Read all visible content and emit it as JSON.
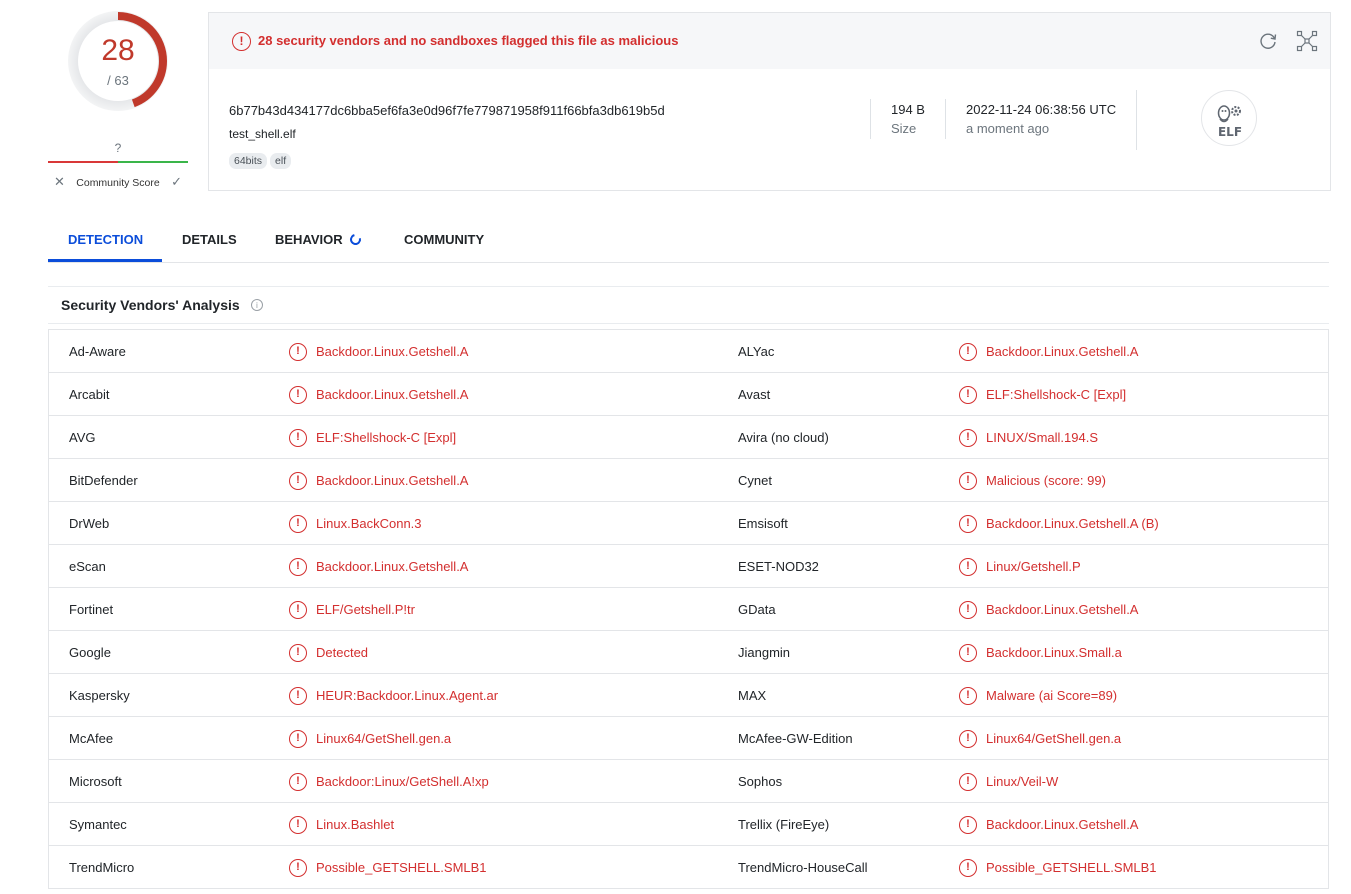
{
  "score": {
    "detections": "28",
    "total": "/ 63",
    "community_q": "?",
    "community_label": "Community Score",
    "x_glyph": "✕",
    "check_glyph": "✓",
    "gauge_fraction": 0.444
  },
  "summary": {
    "alert": "28 security vendors and no sandboxes flagged this file as malicious",
    "alert_glyph": "!",
    "hash": "6b77b43d434177dc6bba5ef6fa3e0d96f7fe779871958f911f66bfa3db619b5d",
    "filename": "test_shell.elf",
    "tags": [
      "64bits",
      "elf"
    ],
    "size_value": "194 B",
    "size_label": "Size",
    "date_value": "2022-11-24 06:38:56 UTC",
    "date_label": "a moment ago",
    "filetype_label": "ELF"
  },
  "tabs": [
    "DETECTION",
    "DETAILS",
    "BEHAVIOR",
    "COMMUNITY"
  ],
  "section_title": "Security Vendors' Analysis",
  "info_glyph": "i",
  "colors": {
    "malicious": "#d32f2f",
    "accent": "#0b4dda",
    "positive": "#3ab54a"
  },
  "vendors": [
    {
      "a": "Ad-Aware",
      "ar": "Backdoor.Linux.Getshell.A",
      "b": "ALYac",
      "br": "Backdoor.Linux.Getshell.A"
    },
    {
      "a": "Arcabit",
      "ar": "Backdoor.Linux.Getshell.A",
      "b": "Avast",
      "br": "ELF:Shellshock-C [Expl]"
    },
    {
      "a": "AVG",
      "ar": "ELF:Shellshock-C [Expl]",
      "b": "Avira (no cloud)",
      "br": "LINUX/Small.194.S"
    },
    {
      "a": "BitDefender",
      "ar": "Backdoor.Linux.Getshell.A",
      "b": "Cynet",
      "br": "Malicious (score: 99)"
    },
    {
      "a": "DrWeb",
      "ar": "Linux.BackConn.3",
      "b": "Emsisoft",
      "br": "Backdoor.Linux.Getshell.A (B)"
    },
    {
      "a": "eScan",
      "ar": "Backdoor.Linux.Getshell.A",
      "b": "ESET-NOD32",
      "br": "Linux/Getshell.P"
    },
    {
      "a": "Fortinet",
      "ar": "ELF/Getshell.P!tr",
      "b": "GData",
      "br": "Backdoor.Linux.Getshell.A"
    },
    {
      "a": "Google",
      "ar": "Detected",
      "b": "Jiangmin",
      "br": "Backdoor.Linux.Small.a"
    },
    {
      "a": "Kaspersky",
      "ar": "HEUR:Backdoor.Linux.Agent.ar",
      "b": "MAX",
      "br": "Malware (ai Score=89)"
    },
    {
      "a": "McAfee",
      "ar": "Linux64/GetShell.gen.a",
      "b": "McAfee-GW-Edition",
      "br": "Linux64/GetShell.gen.a"
    },
    {
      "a": "Microsoft",
      "ar": "Backdoor:Linux/GetShell.A!xp",
      "b": "Sophos",
      "br": "Linux/Veil-W"
    },
    {
      "a": "Symantec",
      "ar": "Linux.Bashlet",
      "b": "Trellix (FireEye)",
      "br": "Backdoor.Linux.Getshell.A"
    },
    {
      "a": "TrendMicro",
      "ar": "Possible_GETSHELL.SMLB1",
      "b": "TrendMicro-HouseCall",
      "br": "Possible_GETSHELL.SMLB1"
    }
  ]
}
